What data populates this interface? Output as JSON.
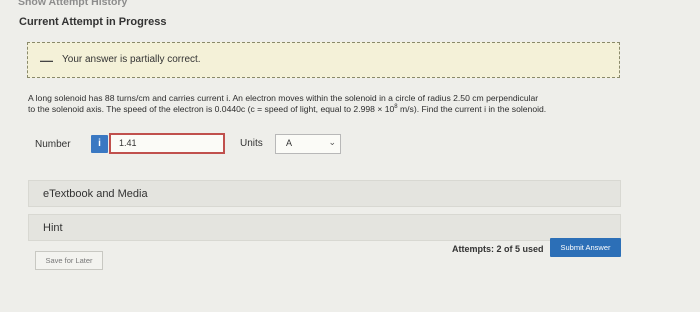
{
  "header": {
    "history_link": "Show Attempt History",
    "attempt_title": "Current Attempt in Progress"
  },
  "feedback": {
    "icon": "minus-icon",
    "message": "Your answer is partially correct."
  },
  "question": {
    "text_line1": "A long solenoid has 88 turns/cm and carries current i. An electron moves within the solenoid in a circle of radius 2.50 cm perpendicular",
    "text_line2a": "to the solenoid axis. The speed of the electron is 0.0440c (c = speed of light, equal to 2.998 × 10",
    "text_exp": "8",
    "text_line2b": " m/s). Find the current i in the solenoid."
  },
  "answer": {
    "number_label": "Number",
    "info_icon": "i",
    "value": "1.41",
    "units_label": "Units",
    "units_value": "A"
  },
  "panels": {
    "etextbook": "eTextbook and Media",
    "hint": "Hint"
  },
  "footer": {
    "attempts": "Attempts: 2 of 5 used",
    "submit": "Submit Answer",
    "save": "Save for Later"
  }
}
